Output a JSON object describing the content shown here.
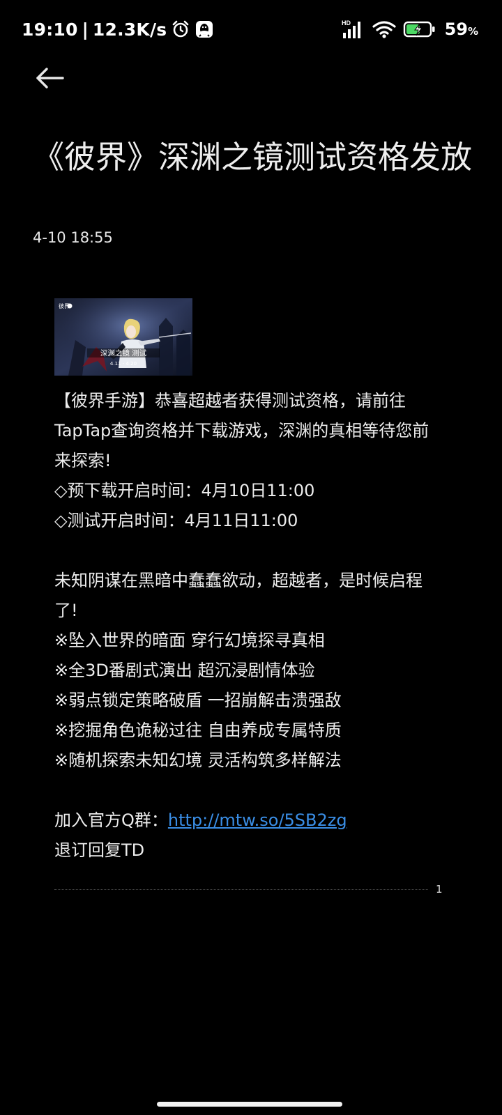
{
  "status_bar": {
    "time": "19:10",
    "network_speed": "12.3K/s",
    "icons": [
      "alarm-icon",
      "qq-icon",
      "hd-signal-icon",
      "wifi-icon",
      "battery-charging-icon"
    ],
    "signal_tag": "HD",
    "battery_level": "59",
    "battery_unit": "%"
  },
  "nav": {
    "back_icon": "back-arrow-icon"
  },
  "message": {
    "title": "《彼界》深渊之镜测试资格发放",
    "date": "4-10 18:55",
    "banner": {
      "logo_text": "彼界",
      "title_text": "深渊之镜 测试",
      "dates_text": "4.11 - 4.20"
    },
    "paragraphs": [
      "【彼界手游】恭喜超越者获得测试资格，请前往TapTap查询资格并下载游戏，深渊的真相等待您前来探索!",
      "◇预下载开启时间：4月10日11:00",
      "◇测试开启时间：4月11日11:00"
    ],
    "paragraphs2": [
      "未知阴谋在黑暗中蠢蠢欲动，超越者，是时候启程了!",
      "※坠入世界的暗面 穿行幻境探寻真相",
      "※全3D番剧式演出 超沉浸剧情体验",
      "※弱点锁定策略破盾 一招崩解击溃强敌",
      "※挖掘角色诡秘过往 自由养成专属特质",
      "※随机探索未知幻境 灵活构筑多样解法"
    ],
    "group_label": "加入官方Q群：",
    "group_link": "http://mtw.so/5SB2zg",
    "unsubscribe": "退订回复TD",
    "page_number": "1"
  },
  "colors": {
    "background": "#000000",
    "text": "#ececec",
    "link": "#3a8ee6",
    "battery_fill": "#4cd964"
  }
}
